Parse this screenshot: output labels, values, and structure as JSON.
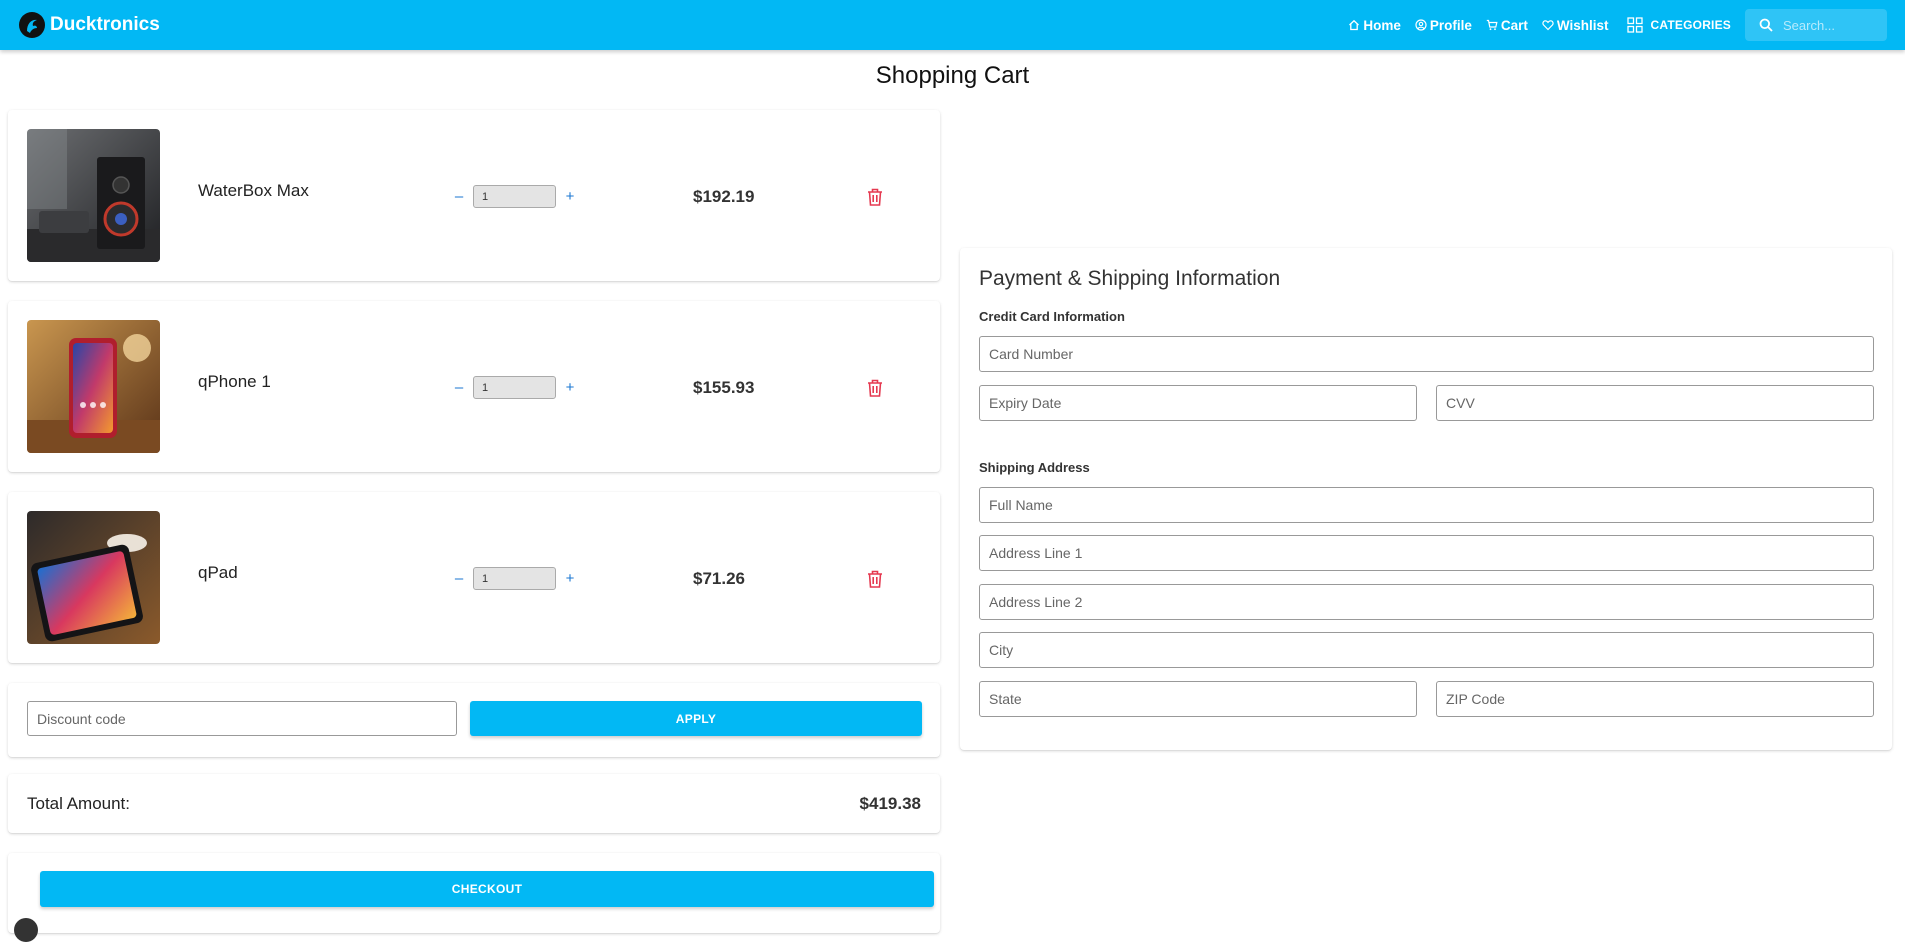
{
  "header": {
    "brand": "Ducktronics",
    "nav": [
      {
        "label": "Home",
        "icon": "home-icon"
      },
      {
        "label": "Profile",
        "icon": "profile-icon"
      },
      {
        "label": "Cart",
        "icon": "cart-icon"
      },
      {
        "label": "Wishlist",
        "icon": "heart-icon"
      }
    ],
    "categories_label": "CATEGORIES",
    "search_placeholder": "Search...",
    "accent_color": "#02b8f4"
  },
  "page_title": "Shopping Cart",
  "cart": {
    "items": [
      {
        "name": "WaterBox Max",
        "quantity": "1",
        "price": "$192.19"
      },
      {
        "name": "qPhone 1",
        "quantity": "1",
        "price": "$155.93"
      },
      {
        "name": "qPad",
        "quantity": "1",
        "price": "$71.26"
      }
    ],
    "minus_label": "–",
    "plus_label": "+",
    "discount_placeholder": "Discount code",
    "apply_label": "APPLY",
    "total_label": "Total Amount:",
    "total_value": "$419.38",
    "checkout_label": "CHECKOUT"
  },
  "payment": {
    "title": "Payment & Shipping Information",
    "credit_label": "Credit Card Information",
    "card_number_placeholder": "Card Number",
    "expiry_placeholder": "Expiry Date",
    "cvv_placeholder": "CVV",
    "shipping_label": "Shipping Address",
    "full_name_placeholder": "Full Name",
    "address1_placeholder": "Address Line 1",
    "address2_placeholder": "Address Line 2",
    "city_placeholder": "City",
    "state_placeholder": "State",
    "zip_placeholder": "ZIP Code"
  }
}
